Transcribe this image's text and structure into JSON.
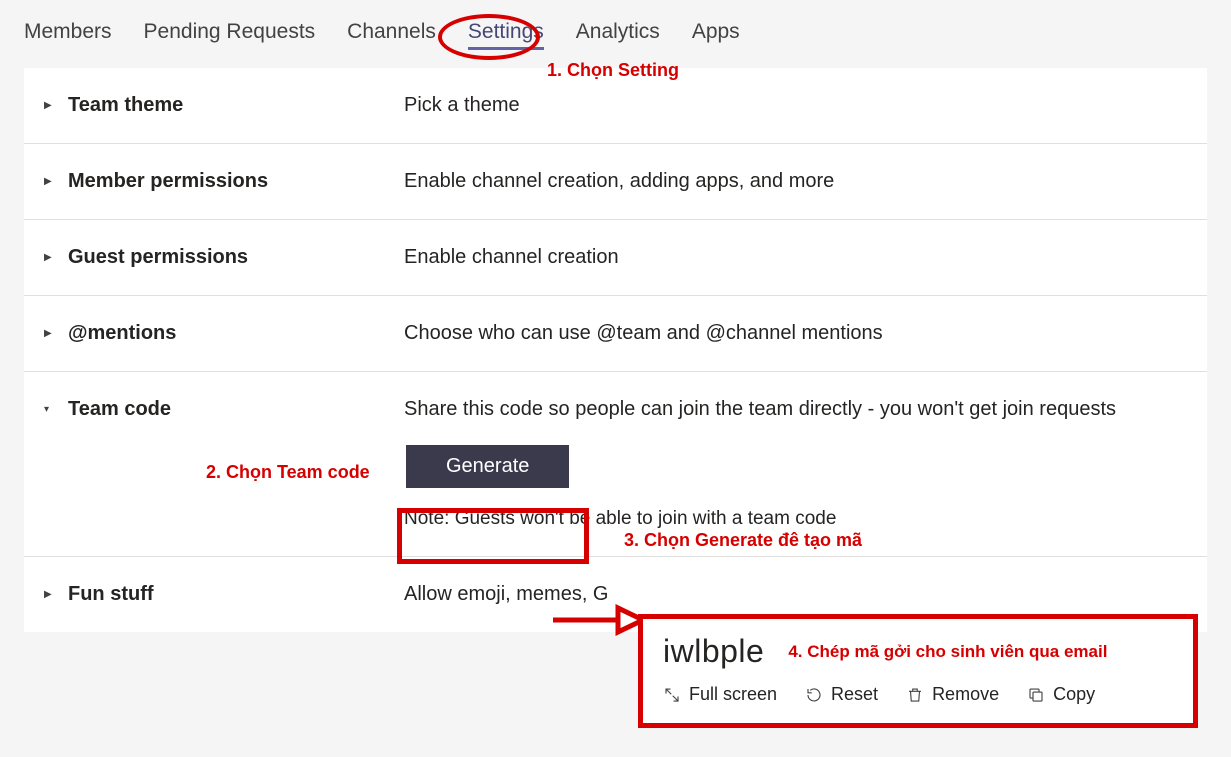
{
  "tabs": {
    "members": "Members",
    "pending": "Pending Requests",
    "channels": "Channels",
    "settings": "Settings",
    "analytics": "Analytics",
    "apps": "Apps"
  },
  "sections": {
    "theme": {
      "title": "Team theme",
      "desc": "Pick a theme"
    },
    "member_perm": {
      "title": "Member permissions",
      "desc": "Enable channel creation, adding apps, and more"
    },
    "guest_perm": {
      "title": "Guest permissions",
      "desc": "Enable channel creation"
    },
    "mentions": {
      "title": "@mentions",
      "desc": "Choose who can use @team and @channel mentions"
    },
    "teamcode": {
      "title": "Team code",
      "desc": "Share this code so people can join the team directly - you won't get join requests",
      "generate": "Generate",
      "note": "Note: Guests won't be able to join with a team code"
    },
    "fun": {
      "title": "Fun stuff",
      "desc": "Allow emoji, memes, G"
    }
  },
  "annotations": {
    "step1": "1. Chọn Setting",
    "step2": "2. Chọn Team code",
    "step3": "3. Chọn Generate đê tạo mã",
    "step4": "4. Chép mã gởi cho sinh viên qua email"
  },
  "popup": {
    "code": "iwlbple",
    "fullscreen": "Full screen",
    "reset": "Reset",
    "remove": "Remove",
    "copy": "Copy"
  }
}
